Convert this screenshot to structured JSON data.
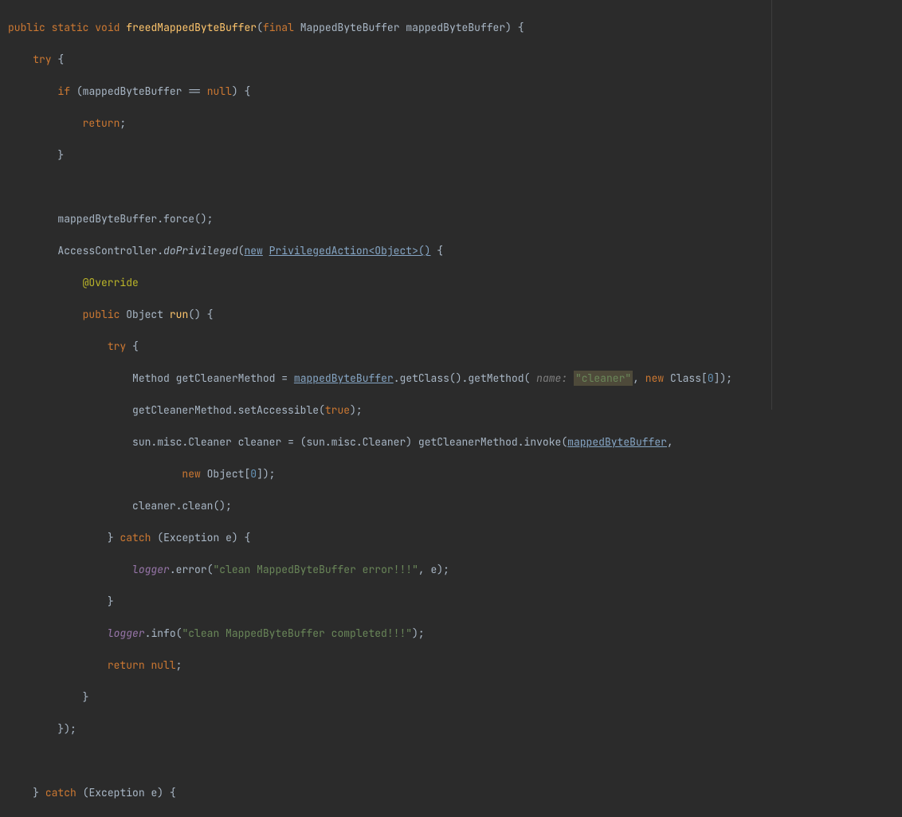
{
  "code": {
    "kw_public": "public",
    "kw_static": "static",
    "kw_void": "void",
    "kw_final": "final",
    "kw_try": "try",
    "kw_if": "if",
    "kw_return": "return",
    "kw_catch": "catch",
    "kw_new": "new",
    "kw_null": "null",
    "kw_true": "true",
    "type_MappedByteBuffer": "MappedByteBuffer",
    "type_Object": "Object",
    "type_Method": "Method",
    "type_Class": "Class",
    "type_Exception": "Exception",
    "method_freedMappedByteBuffer": "freedMappedByteBuffer",
    "method_doPrivileged": "doPrivileged",
    "method_run": "run",
    "method_force": "force",
    "method_getClass": "getClass",
    "method_getMethod": "getMethod",
    "method_setAccessible": "setAccessible",
    "method_invoke": "invoke",
    "method_clean": "clean",
    "method_error": "error",
    "method_info": "info",
    "param_mappedByteBuffer": "mappedByteBuffer",
    "ident_AccessController": "AccessController",
    "ident_getCleanerMethod": "getCleanerMethod",
    "ident_cleaner": "cleaner",
    "ident_logger": "logger",
    "ident_e": "e",
    "anno_Override": "@Override",
    "generic_PrivilegedAction": "PrivilegedAction<Object>()",
    "sun_misc_Cleaner": "sun.misc.Cleaner",
    "hint_name": "name:",
    "string_cleaner": "\"cleaner\"",
    "string_error": "\"clean MappedByteBuffer error!!!\"",
    "string_completed": "\"clean MappedByteBuffer completed!!!\"",
    "num_zero": "0",
    "eq_eq": "==",
    "lbrace": "{",
    "rbrace": "}",
    "lparen": "(",
    "rparen": ")",
    "lbracket": "[",
    "rbracket": "]",
    "semi": ";",
    "dot": ".",
    "comma": ",",
    "assign": "="
  }
}
